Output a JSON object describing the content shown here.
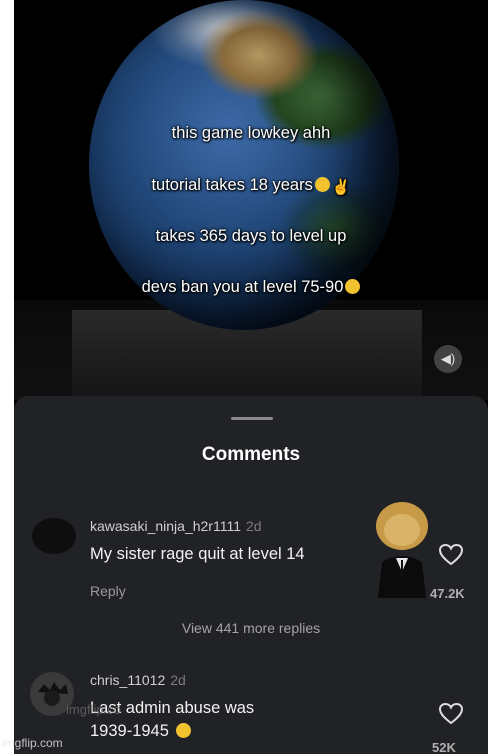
{
  "video": {
    "captions": [
      "this game lowkey ahh",
      "tutorial takes 18 years",
      "takes 365 days to level up",
      "devs ban you at level 75-90"
    ],
    "volume_icon": "speaker-icon"
  },
  "comments_panel": {
    "title": "Comments",
    "comments": [
      {
        "username": "kawasaki_ninja_h2r1111",
        "time": "2d",
        "text": "My sister rage quit at level 14",
        "reply_label": "Reply",
        "likes": "47.2K"
      },
      {
        "username": "chris_11012",
        "time": "2d",
        "text_line1": "Last admin abuse was",
        "text_line2": "1939-1945",
        "likes": "52K"
      }
    ],
    "view_more": "View 441 more replies"
  },
  "watermark": {
    "text": "imgflip.com",
    "partial": "imgflip.co"
  },
  "colors": {
    "sheet_bg": "#202225",
    "emoji_yellow": "#f2c12e"
  }
}
